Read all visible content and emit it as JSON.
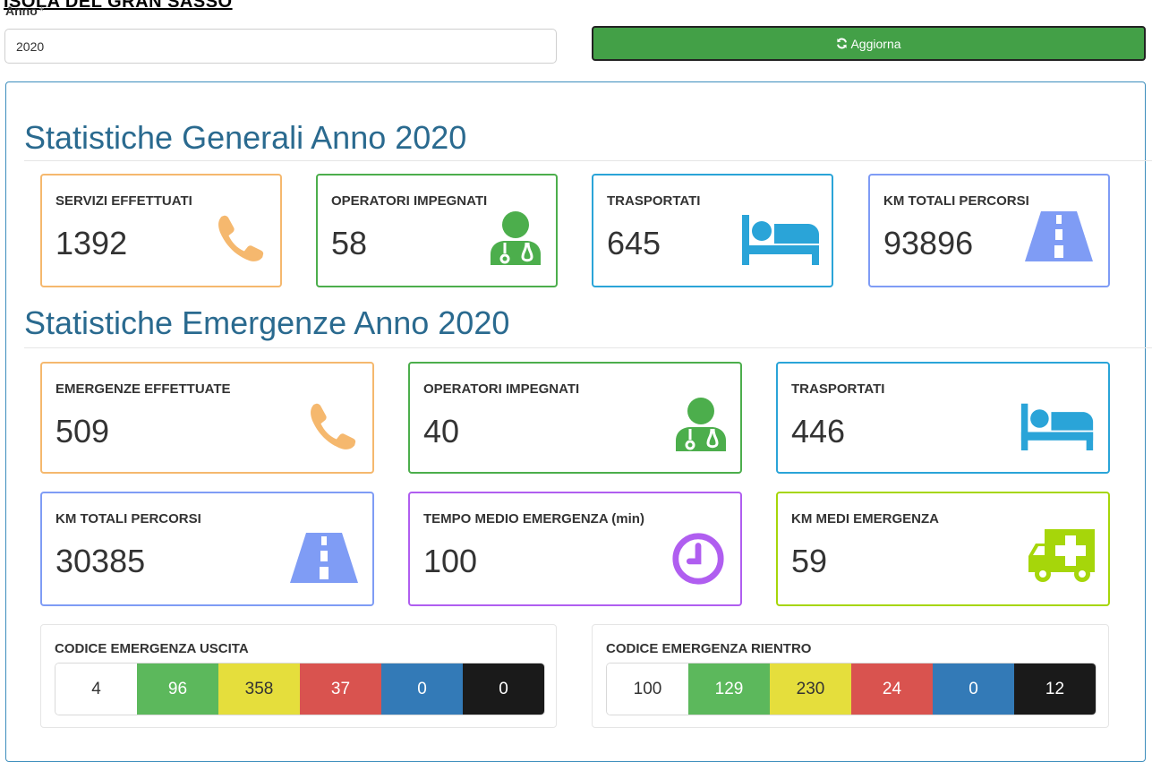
{
  "header": {
    "cut_title": "ISOLA DEL GRAN SASSO",
    "year_label": "Anno",
    "required_mark": "*",
    "year_value": "2020",
    "refresh_label": "Aggiorna"
  },
  "general": {
    "title": "Statistiche Generali Anno 2020",
    "cards": [
      {
        "label": "SERVIZI EFFETTUATI",
        "value": "1392",
        "icon": "phone-icon",
        "color": "#f5b86e"
      },
      {
        "label": "OPERATORI IMPEGNATI",
        "value": "58",
        "icon": "user-md-icon",
        "color": "#4cae4c"
      },
      {
        "label": "TRASPORTATI",
        "value": "645",
        "icon": "bed-icon",
        "color": "#2aa4d8"
      },
      {
        "label": "KM TOTALI PERCORSI",
        "value": "93896",
        "icon": "road-icon",
        "color": "#7f9cf5"
      }
    ]
  },
  "emergency": {
    "title": "Statistiche Emergenze Anno 2020",
    "cards": [
      {
        "label": "EMERGENZE EFFETTUATE",
        "value": "509",
        "icon": "phone-icon",
        "color": "#f5b86e"
      },
      {
        "label": "OPERATORI IMPEGNATI",
        "value": "40",
        "icon": "user-md-icon",
        "color": "#4cae4c"
      },
      {
        "label": "TRASPORTATI",
        "value": "446",
        "icon": "bed-icon",
        "color": "#2aa4d8"
      },
      {
        "label": "KM TOTALI PERCORSI",
        "value": "30385",
        "icon": "road-icon",
        "color": "#7f9cf5"
      },
      {
        "label": "TEMPO MEDIO EMERGENZA (min)",
        "value": "100",
        "icon": "clock-icon",
        "color": "#b05ef0"
      },
      {
        "label": "KM MEDI EMERGENZA",
        "value": "59",
        "icon": "ambulance-icon",
        "color": "#a6d60a"
      }
    ]
  },
  "codes": {
    "code_colors": [
      "#ffffff",
      "#5cb85c",
      "#e5de3c",
      "#d9534f",
      "#337ab7",
      "#1a1a1a"
    ],
    "code_text_colors": [
      "#333333",
      "#ffffff",
      "#333333",
      "#ffffff",
      "#ffffff",
      "#ffffff"
    ],
    "uscita": {
      "label": "CODICE EMERGENZA USCITA",
      "values": [
        "4",
        "96",
        "358",
        "37",
        "0",
        "0"
      ]
    },
    "rientro": {
      "label": "CODICE EMERGENZA RIENTRO",
      "values": [
        "100",
        "129",
        "230",
        "24",
        "0",
        "12"
      ]
    }
  }
}
